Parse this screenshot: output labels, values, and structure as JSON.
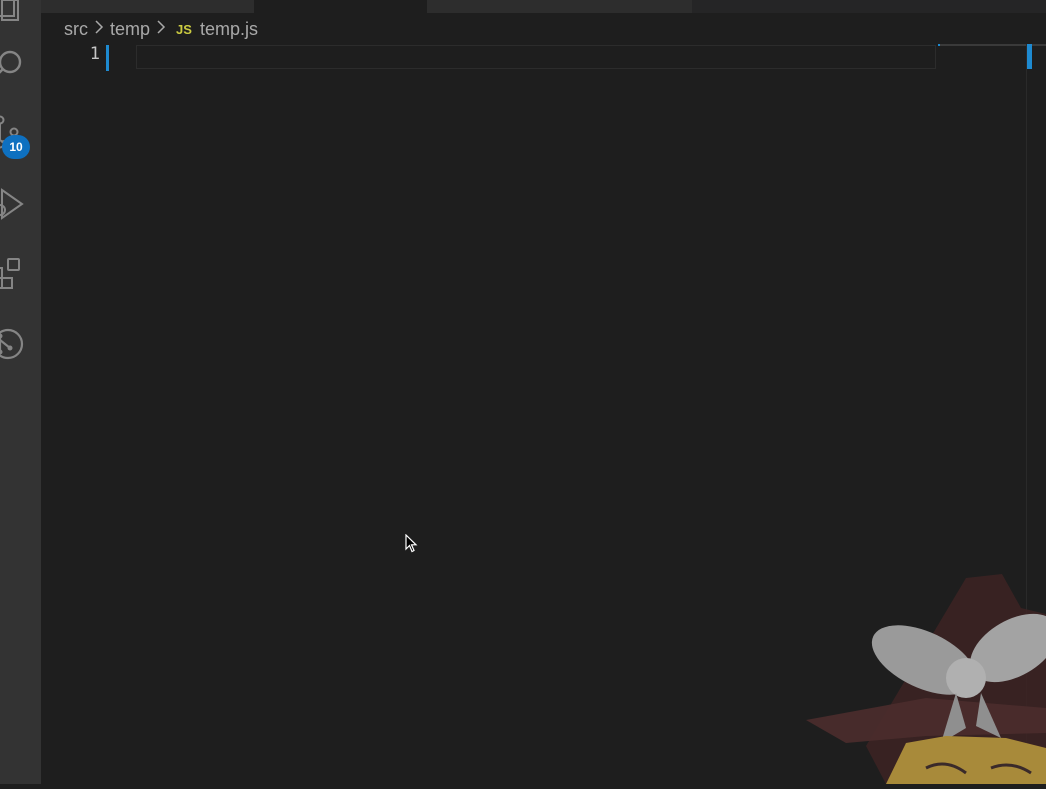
{
  "activity_bar": {
    "icons": [
      "explorer-icon",
      "search-icon",
      "source-control-icon",
      "run-debug-icon",
      "extensions-icon",
      "git-graph-icon"
    ],
    "source_control_badge": "10",
    "badge_color": "#0e70c0"
  },
  "breadcrumb": {
    "items": [
      "src",
      "temp"
    ],
    "file_icon": "JS",
    "file_name": "temp.js"
  },
  "editor": {
    "line_numbers": [
      "1"
    ],
    "background": "#1e1e1e",
    "cursor_color": "#1e8ad0"
  }
}
